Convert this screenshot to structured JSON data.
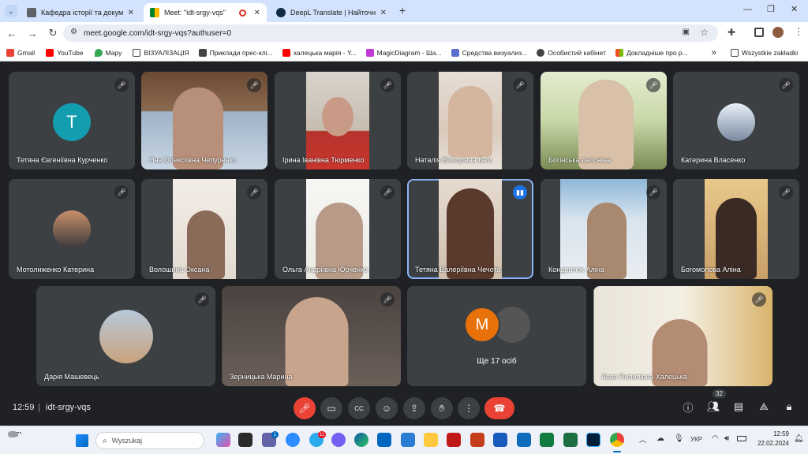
{
  "browser": {
    "tabs": [
      {
        "title": "Кафедра історії та документозн"
      },
      {
        "title": "Meet: \"idt-srgy-vqs\""
      },
      {
        "title": "DeepL Translate | Найточніший"
      }
    ],
    "new_tab": "+",
    "url": "meet.google.com/idt-srgy-vqs?authuser=0",
    "bookmarks": [
      "Gmail",
      "YouTube",
      "Mapy",
      "ВІЗУАЛІЗАЦІЯ",
      "Приклади прес-клі...",
      "халецька марія - Y...",
      "MagicDiagram - Ша...",
      "Средства визуализ...",
      "Особистий кабінет",
      "Докладніше про р..."
    ],
    "bookmarks_more": "»",
    "all_bookmarks": "Wszystkie zakładki"
  },
  "meet": {
    "participants": [
      {
        "name": "Тетяна Євгеніївна Курченко",
        "initial": "T"
      },
      {
        "name": "Яна Олексіївна Чепуренко"
      },
      {
        "name": "Ірина Іванівна Тюрменко"
      },
      {
        "name": "Наталія Вікторівна Бем"
      },
      {
        "name": "Богінська Антоніна"
      },
      {
        "name": "Катерина Власенко"
      },
      {
        "name": "Мотолиженко Катерина"
      },
      {
        "name": "Волошина Оксана"
      },
      {
        "name": "Ольга Андріївна Юрченко"
      },
      {
        "name": "Тетяна Валеріївна Чечота"
      },
      {
        "name": "Кондратюк Аліна"
      },
      {
        "name": "Богомолова Аліна"
      },
      {
        "name": "Дарія Машевець"
      },
      {
        "name": "Зерницька Марина"
      },
      {
        "name": "Леся Пилипівна Халецька"
      }
    ],
    "others": {
      "label": "Ще 17 осіб",
      "initial": "M"
    },
    "time": "12:59",
    "meeting_code": "idt-srgy-vqs",
    "people_count": "32"
  },
  "taskbar": {
    "search_placeholder": "Wyszukaj",
    "weather": "7°",
    "lang": "УКР",
    "time": "12:59",
    "date": "22.02.2024",
    "badge_1": "1",
    "badge_2": "11"
  },
  "colors": {
    "accent": "#1a73e8",
    "red": "#ea4335",
    "avatar_teal": "#129eaf",
    "avatar_orange": "#e8710a"
  }
}
